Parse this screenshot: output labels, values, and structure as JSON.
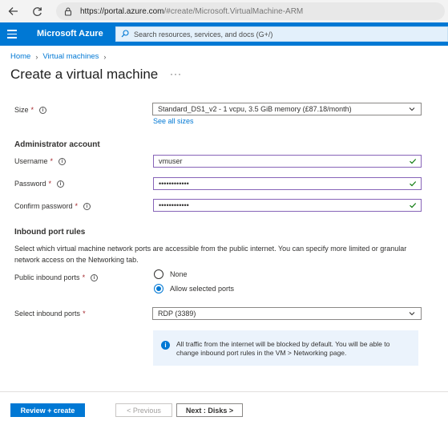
{
  "browser": {
    "url_host": "https://portal.azure.com",
    "url_path": "/#create/Microsoft.VirtualMachine-ARM"
  },
  "header": {
    "brand": "Microsoft Azure",
    "search_placeholder": "Search resources, services, and docs (G+/)"
  },
  "breadcrumb": {
    "home": "Home",
    "vms": "Virtual machines"
  },
  "page": {
    "title": "Create a virtual machine",
    "more": "···"
  },
  "size": {
    "label": "Size",
    "value": "Standard_DS1_v2 - 1 vcpu, 3.5 GiB memory (£87.18/month)",
    "see_all": "See all sizes"
  },
  "admin": {
    "heading": "Administrator account",
    "username_label": "Username",
    "username_value": "vmuser",
    "password_label": "Password",
    "password_value": "••••••••••••",
    "confirm_label": "Confirm password",
    "confirm_value": "••••••••••••"
  },
  "inbound": {
    "heading": "Inbound port rules",
    "description": "Select which virtual machine network ports are accessible from the public internet. You can specify more limited or granular network access on the Networking tab.",
    "public_label": "Public inbound ports",
    "options": [
      "None",
      "Allow selected ports"
    ],
    "selected_option": "Allow selected ports",
    "select_label": "Select inbound ports",
    "select_value": "RDP (3389)",
    "info": "All traffic from the internet will be blocked by default. You will be able to change inbound port rules in the VM > Networking page."
  },
  "footer": {
    "review_create": "Review + create",
    "previous": "< Previous",
    "next": "Next : Disks >"
  },
  "colors": {
    "azure_blue": "#0078d4",
    "valid_green": "#107c10",
    "focus_purple": "#8764b8"
  }
}
